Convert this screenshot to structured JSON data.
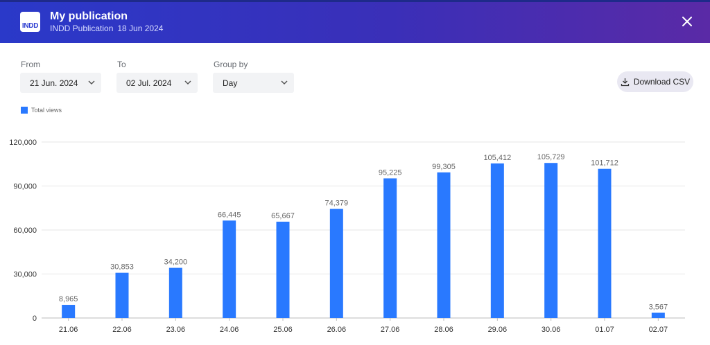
{
  "header": {
    "logo_text": "INDD",
    "title": "My publication",
    "subtitle_type": "INDD Publication",
    "subtitle_date": "18 Jun 2024"
  },
  "filters": {
    "from_label": "From",
    "from_value": "21 Jun. 2024",
    "to_label": "To",
    "to_value": "02 Jul. 2024",
    "group_label": "Group by",
    "group_value": "Day"
  },
  "download_label": "Download CSV",
  "colors": {
    "bar": "#2979ff",
    "header_start": "#2a39c9",
    "header_end": "#5a2aa6"
  },
  "chart_data": {
    "type": "bar",
    "categories": [
      "21.06",
      "22.06",
      "23.06",
      "24.06",
      "25.06",
      "26.06",
      "27.06",
      "28.06",
      "29.06",
      "30.06",
      "01.07",
      "02.07"
    ],
    "series": [
      {
        "name": "Total views",
        "values": [
          8965,
          30853,
          34200,
          66445,
          65667,
          74379,
          95225,
          99305,
          105412,
          105729,
          101712,
          3567
        ]
      }
    ],
    "data_labels": [
      "8,965",
      "30,853",
      "34,200",
      "66,445",
      "65,667",
      "74,379",
      "95,225",
      "99,305",
      "105,412",
      "105,729",
      "101,712",
      "3,567"
    ],
    "y_ticks": [
      "0",
      "30,000",
      "60,000",
      "90,000",
      "120,000"
    ],
    "ylim": [
      0,
      120000
    ],
    "grid": true,
    "legend": "top-left"
  }
}
